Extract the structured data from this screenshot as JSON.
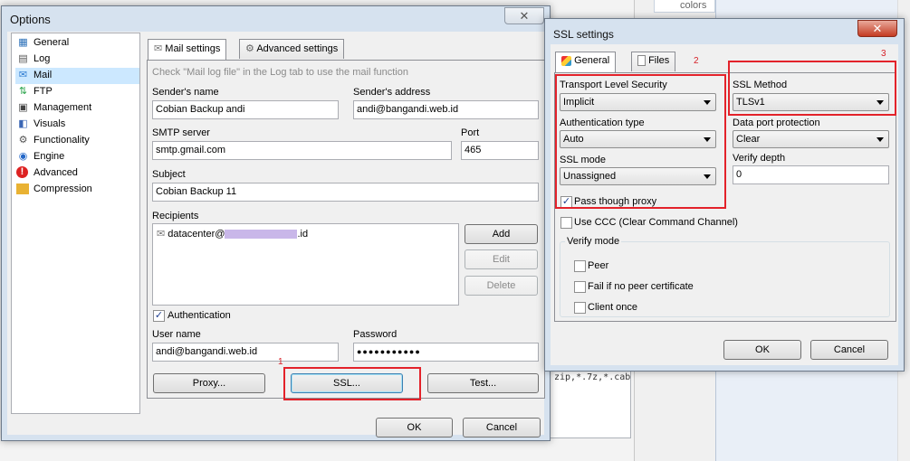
{
  "background": {
    "colors_label": "colors",
    "textarea_text": "zip,*.7z,*.cab"
  },
  "options": {
    "title": "Options",
    "close": "✕",
    "sidebar": [
      {
        "label": "General",
        "icon": "general-icon"
      },
      {
        "label": "Log",
        "icon": "log-icon"
      },
      {
        "label": "Mail",
        "icon": "mail-icon",
        "selected": true
      },
      {
        "label": "FTP",
        "icon": "ftp-icon"
      },
      {
        "label": "Management",
        "icon": "management-icon"
      },
      {
        "label": "Visuals",
        "icon": "visuals-icon"
      },
      {
        "label": "Functionality",
        "icon": "functionality-icon"
      },
      {
        "label": "Engine",
        "icon": "engine-icon"
      },
      {
        "label": "Advanced",
        "icon": "advanced-icon"
      },
      {
        "label": "Compression",
        "icon": "compression-icon"
      }
    ],
    "tabs": {
      "mail_settings": "Mail settings",
      "advanced_settings": "Advanced settings"
    },
    "hint": "Check \"Mail log file\" in the Log tab to use the mail function",
    "sender_name": {
      "label": "Sender's name",
      "value": "Cobian Backup andi"
    },
    "sender_address": {
      "label": "Sender's address",
      "value": "andi@bangandi.web.id"
    },
    "smtp": {
      "label": "SMTP server",
      "value": "smtp.gmail.com"
    },
    "port": {
      "label": "Port",
      "value": "465"
    },
    "subject": {
      "label": "Subject",
      "value": "Cobian Backup 11"
    },
    "recipients": {
      "label": "Recipients",
      "items": [
        {
          "prefix": "datacenter@",
          "suffix": ".id"
        }
      ]
    },
    "buttons": {
      "add": "Add",
      "edit": "Edit",
      "delete": "Delete",
      "proxy": "Proxy...",
      "ssl": "SSL...",
      "test": "Test...",
      "ok": "OK",
      "cancel": "Cancel"
    },
    "authentication": {
      "label": "Authentication",
      "checked": true,
      "mark": "✓"
    },
    "username": {
      "label": "User name",
      "value": "andi@bangandi.web.id"
    },
    "password": {
      "label": "Password",
      "value": "●●●●●●●●●●●"
    },
    "annotation": "1"
  },
  "ssl": {
    "title": "SSL settings",
    "close": "✕",
    "tabs": {
      "general": "General",
      "files": "Files"
    },
    "annotations": {
      "two": "2",
      "three": "3"
    },
    "tls": {
      "label": "Transport Level Security",
      "value": "Implicit"
    },
    "auth_type": {
      "label": "Authentication type",
      "value": "Auto"
    },
    "ssl_mode": {
      "label": "SSL mode",
      "value": "Unassigned"
    },
    "pass_proxy": {
      "label": "Pass though proxy",
      "checked": true,
      "mark": "✓"
    },
    "ssl_method": {
      "label": "SSL Method",
      "value": "TLSv1"
    },
    "data_port": {
      "label": "Data port protection",
      "value": "Clear"
    },
    "verify_depth": {
      "label": "Verify depth",
      "value": "0"
    },
    "use_ccc": {
      "label": "Use CCC (Clear Command Channel)",
      "checked": false
    },
    "verify_mode": {
      "label": "Verify mode",
      "peer": "Peer",
      "fail": "Fail if no peer certificate",
      "client_once": "Client once"
    },
    "buttons": {
      "ok": "OK",
      "cancel": "Cancel"
    }
  }
}
